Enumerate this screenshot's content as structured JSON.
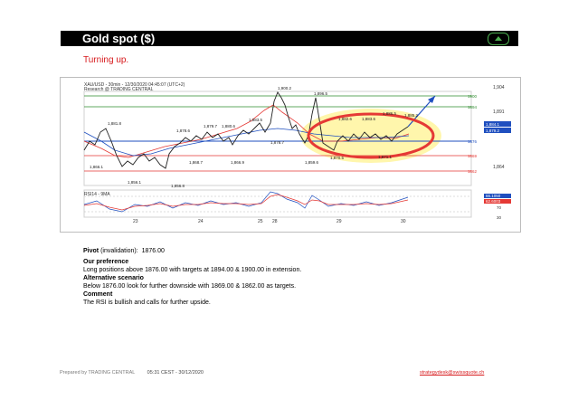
{
  "header": {
    "title": "Gold spot ($)"
  },
  "subtitle": "Turning up.",
  "chart": {
    "instrument_line": "XAU/USD - 30min - 12/30/2020 04:45:07 (UTC+2)",
    "source_line": "Research @ TRADING CENTRAL",
    "price_ticks": [
      "1,904",
      "1,891",
      "1,864"
    ],
    "level_tags": [
      "1900",
      "1894",
      "1876",
      "1869",
      "1862"
    ],
    "price_labels": [
      "1,884.1",
      "1,879.2"
    ],
    "callouts": [
      "1,900.2",
      "1,896.5",
      "1,881.8",
      "1,878.6",
      "1,879.7",
      "1,880.6",
      "1,883.5",
      "1,882.6",
      "1,883.6",
      "1,886.5",
      "1,885.2",
      "1,866.1",
      "1,856.1",
      "1,856.8",
      "1,868.7",
      "1,866.9",
      "1,878.7",
      "1,859.6",
      "1,870.5",
      "1,871.1"
    ],
    "date_labels": [
      "23",
      "24",
      "25",
      "28",
      "29",
      "30"
    ],
    "rsi_label": "RSI14 - 9MA",
    "rsi_values": [
      "66.1050",
      "62.6003"
    ],
    "rsi_ticks": [
      "70",
      "30"
    ]
  },
  "analysis": {
    "pivot_label": "Pivot",
    "pivot_note": "(invalidation):",
    "pivot_value": "1876.00",
    "preference_label": "Our preference",
    "preference_text": "Long positions above 1876.00 with targets at 1894.00 & 1900.00 in extension.",
    "alternative_label": "Alternative scenario",
    "alternative_text": "Below 1876.00 look for further downside with 1869.00 & 1862.00 as targets.",
    "comment_label": "Comment",
    "comment_text": "The RSI is bullish and calls for further upside."
  },
  "footer": {
    "prepared_by": "Prepared by TRADING CENTRAL",
    "timestamp": "05:31 CEST - 30/12/2020",
    "email": "strategydesk@swissquote.ch"
  },
  "colors": {
    "header_bg": "#000000",
    "accent_red": "#d7191c",
    "level_green": "#2e8b2e",
    "level_red": "#e53935",
    "pivot_blue": "#1f4fbf",
    "highlight_yellow": "#fff59d"
  }
}
